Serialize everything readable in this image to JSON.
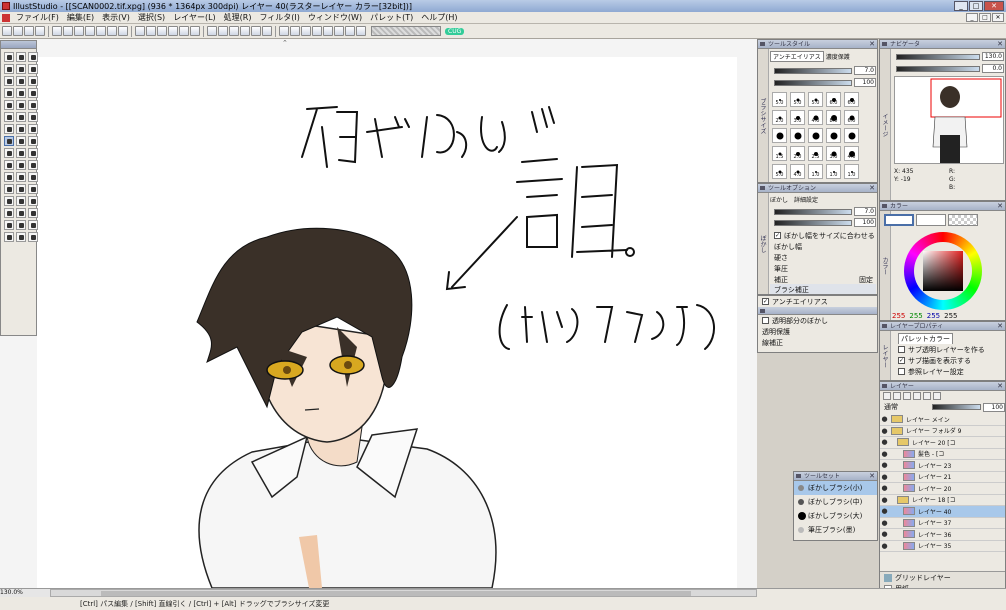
{
  "window": {
    "title": "IllustStudio - [[SCAN0002.tif.xpg] (936 * 1364px 300dpi) レイヤー 40(ラスターレイヤー カラー[32bit])]",
    "controls": [
      "_",
      "□",
      "✕"
    ]
  },
  "menu": {
    "items": [
      "ファイル(F)",
      "編集(E)",
      "表示(V)",
      "選択(S)",
      "レイヤー(L)",
      "処理(R)",
      "フィルタ(I)",
      "ウィンドウ(W)",
      "パレット(T)",
      "ヘルプ(H)"
    ]
  },
  "toolbar": {
    "zoom_badge": "CUG"
  },
  "canvas": {
    "drawn_text_1": "初がない…",
    "drawn_text_2": "誰。",
    "drawn_text_3": "(オリキャラですだ)"
  },
  "tool_style": {
    "title": "ツールスタイル",
    "tab1": "アンチエイリアス",
    "tab2": "濃度保護",
    "size": "7.0",
    "density": "100",
    "brush_labels": [
      "5.0",
      "5.0",
      "5.0",
      "6.0",
      "6.0",
      "2.0",
      "3.0",
      "4.0",
      "8.0",
      "6.0",
      "",
      "",
      "",
      "",
      "",
      "1.5",
      "2.0",
      "2.5",
      "3.0",
      "4.0",
      "5.0",
      "4.0",
      "1.0",
      "1.0",
      "1.0"
    ],
    "side_tab": "ブラシサイズ"
  },
  "tool_option": {
    "title": "ツールオプション",
    "tab1": "ぼかし",
    "tab2": "詳細設定",
    "value1": "7.0",
    "value2": "100",
    "rows": [
      "ぼかし幅をサイズに合わせる",
      "ぼかし幅",
      "硬さ",
      "筆圧",
      "補正"
    ],
    "row_value": "固定",
    "blank": "ブラシ補正",
    "aa": "アンチエイリアス",
    "side_tab": "ぼかし"
  },
  "tool_option2": {
    "rows": [
      "透明部分のぼかし",
      "透明保護",
      "線補正"
    ],
    "side": "off"
  },
  "navigator": {
    "title": "ナビゲータ",
    "zoom": "130.0",
    "angle": "0.0",
    "x": "X: 435",
    "y": "Y: -19",
    "r": "R:",
    "g": "G:",
    "b": "B:",
    "side_tab": "イメージ"
  },
  "color": {
    "title": "カラー",
    "values": [
      "255",
      "255",
      "255",
      "255"
    ],
    "side_tab": "カラー"
  },
  "layer_property": {
    "title": "レイヤープロパティ",
    "tab": "パレットカラー",
    "rows": [
      "サブ透明レイヤーを作る",
      "サブ描画を表示する",
      "参照レイヤー設定"
    ],
    "side_tab": "レイヤー"
  },
  "layers": {
    "title": "レイヤー",
    "mode": "通常",
    "opacity": "100",
    "items": [
      {
        "name": "レイヤー メイン",
        "type": "folder",
        "sel": false
      },
      {
        "name": "レイヤー フォルダ 9",
        "type": "folder",
        "sel": false
      },
      {
        "name": "レイヤー 20 [コ",
        "type": "folder",
        "sel": false
      },
      {
        "name": "髪色 - [コ",
        "type": "raster",
        "sel": false
      },
      {
        "name": "レイヤー 23",
        "type": "raster",
        "sel": false
      },
      {
        "name": "レイヤー 21",
        "type": "raster",
        "sel": false
      },
      {
        "name": "レイヤー 20",
        "type": "raster",
        "sel": false
      },
      {
        "name": "レイヤー 18 [コ",
        "type": "folder",
        "sel": false
      },
      {
        "name": "レイヤー 40",
        "type": "raster",
        "sel": true
      },
      {
        "name": "レイヤー 37",
        "type": "raster",
        "sel": false
      },
      {
        "name": "レイヤー 36",
        "type": "raster",
        "sel": false
      },
      {
        "name": "レイヤー 35",
        "type": "raster",
        "sel": false
      }
    ],
    "bottom": [
      "グリッドレイヤー",
      "用紙"
    ]
  },
  "tool_set": {
    "title": "ツールセット",
    "items": [
      "ぼかしブラシ(小)",
      "ぼかしブラシ(中)",
      "ぼかしブラシ(大)",
      "筆圧ブラシ(墨)"
    ]
  },
  "status": {
    "zoom": "130.0%",
    "message": "[Ctrl] パス編集 / [Shift] 直線引く / [Ctrl] + [Alt] ドラッグでブラシサイズ変更"
  }
}
